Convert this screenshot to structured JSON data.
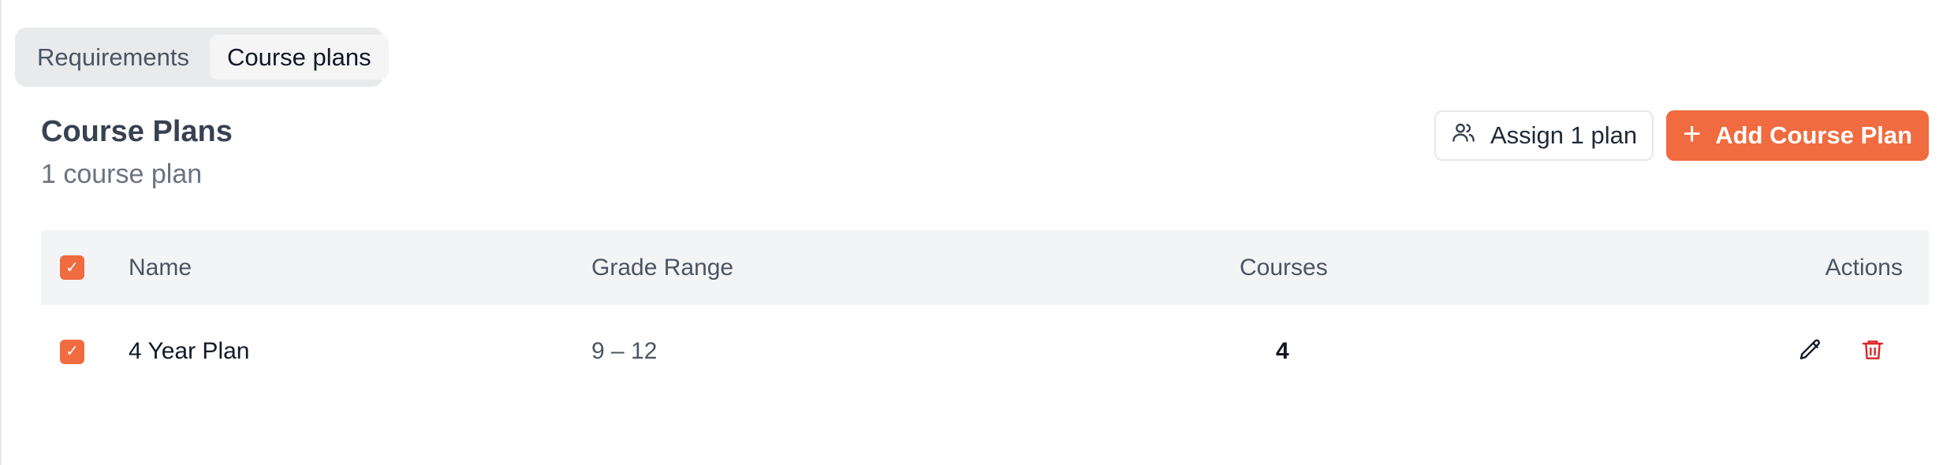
{
  "tabs": [
    {
      "label": "Requirements",
      "active": false
    },
    {
      "label": "Course plans",
      "active": true
    }
  ],
  "header": {
    "title": "Course Plans",
    "subtitle": "1 course plan",
    "assign_label": "Assign 1 plan",
    "add_label": "Add Course Plan"
  },
  "table": {
    "columns": {
      "name": "Name",
      "grade_range": "Grade Range",
      "courses": "Courses",
      "actions": "Actions"
    },
    "select_all_checked": true,
    "rows": [
      {
        "checked": true,
        "name": "4 Year Plan",
        "grade_range": "9 – 12",
        "courses": "4"
      }
    ]
  },
  "icons": {
    "assign": "users-icon",
    "add": "plus-icon",
    "edit": "pencil-icon",
    "delete": "trash-icon",
    "checkbox": "check-icon"
  },
  "colors": {
    "accent": "#f06b3f",
    "danger": "#dc2626",
    "header_bg": "#f3f4f6"
  }
}
